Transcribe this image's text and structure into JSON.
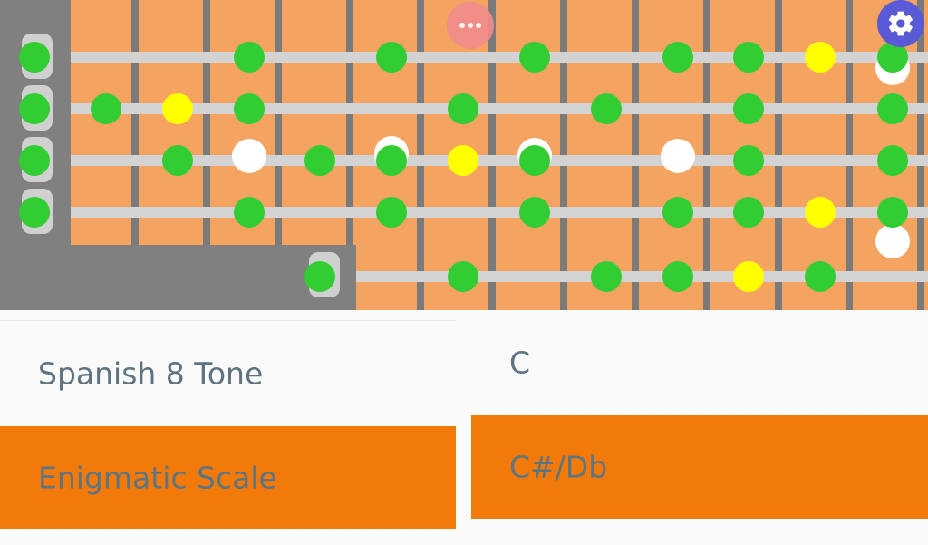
{
  "colors": {
    "fretboard_background": "#808080",
    "board": "#f4a460",
    "fret": "#7a7a7a",
    "string": "#d3d3d3",
    "scale_note": "#32cd32",
    "root_note": "#ffff00",
    "empty_marker": "#ffffff",
    "selected_row": "#f27a0a",
    "text": "#5e7480"
  },
  "fab_buttons": {
    "more_icon": "more-horizontal-icon",
    "settings_icon": "gear-icon"
  },
  "scale_picker": {
    "options": [
      "Spanish 8 Tone",
      "Enigmatic Scale"
    ],
    "selected": "Enigmatic Scale"
  },
  "key_picker": {
    "options": [
      "C",
      "C#/Db"
    ],
    "selected": "C#/Db"
  }
}
